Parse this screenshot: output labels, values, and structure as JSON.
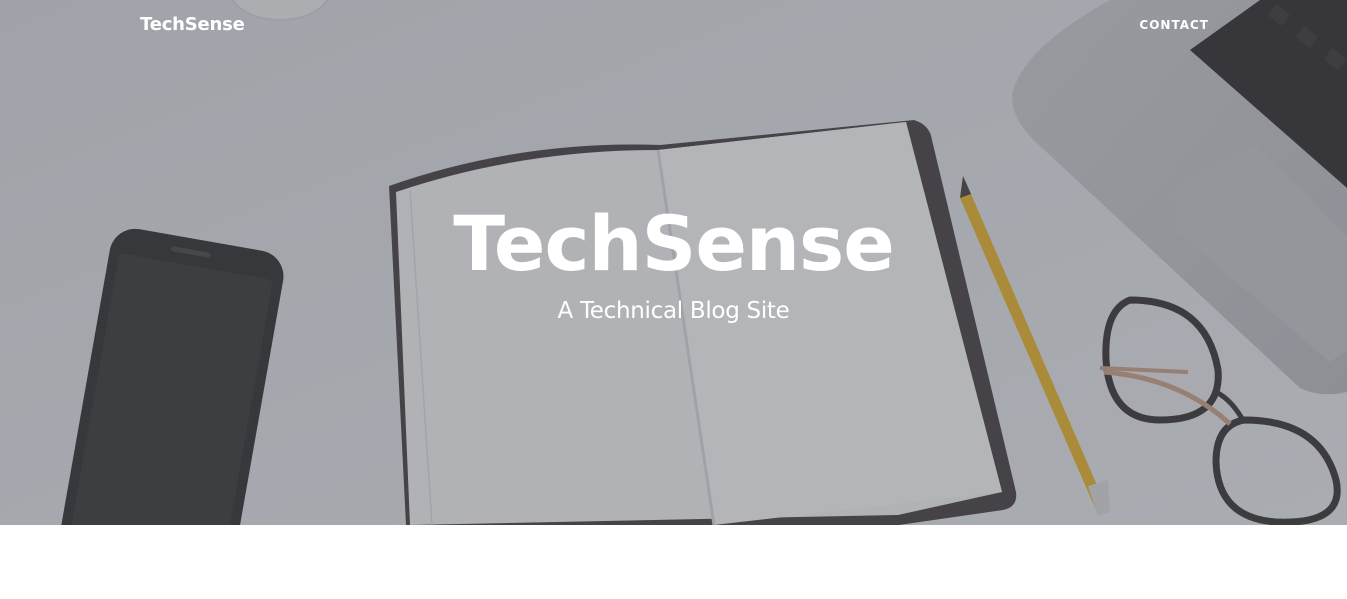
{
  "navbar": {
    "brand": "TechSense",
    "contact_label": "CONTACT"
  },
  "hero": {
    "title": "TechSense",
    "subtitle": "A Technical Blog Site",
    "background": "desk-photo-notebook-phone-pencil-glasses-laptop"
  },
  "colors": {
    "text": "#ffffff",
    "overlay": "#565a62",
    "page_background": "#ffffff"
  }
}
